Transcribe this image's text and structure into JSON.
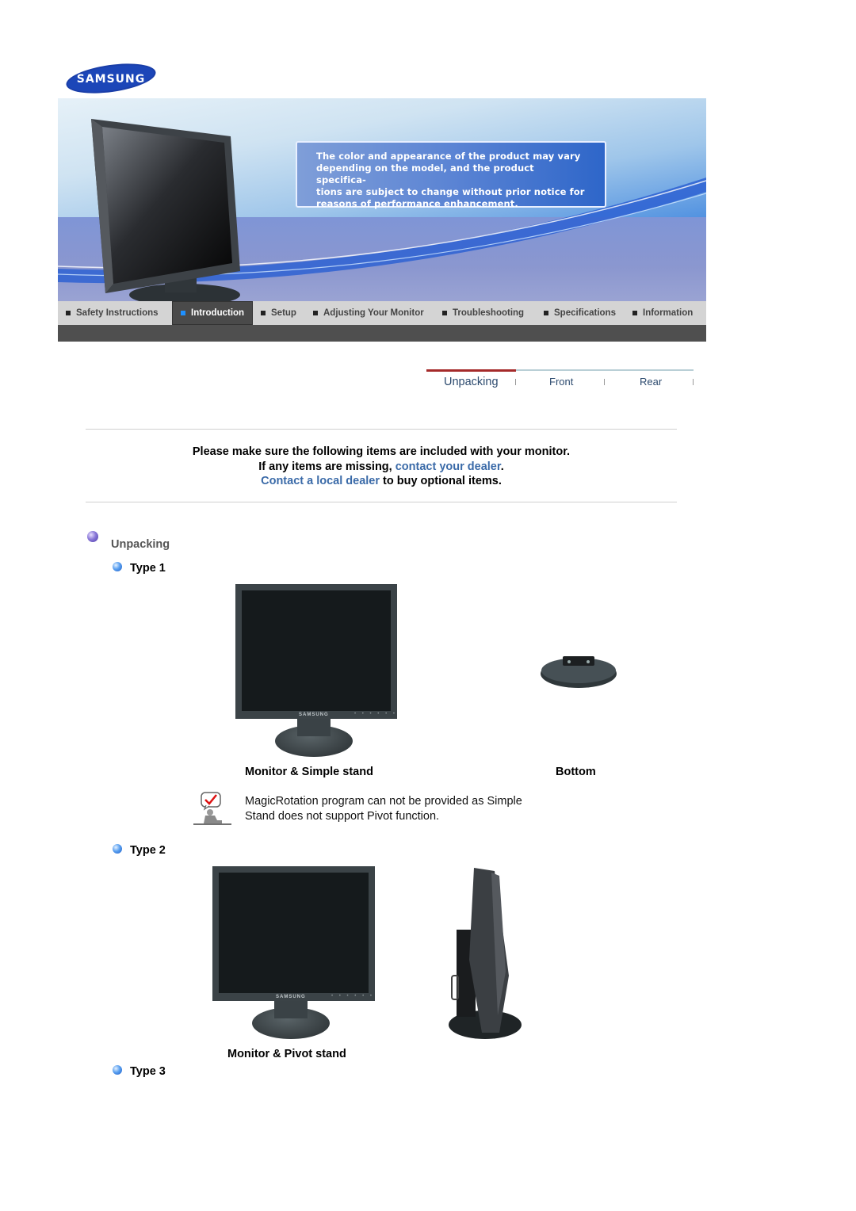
{
  "brand": {
    "logo_text": "SAMSUNG",
    "logo_color": "#1428a0"
  },
  "banner": {
    "notice": "The color and appearance of the product may vary depending on the model, and the product specifica-tions are subject to change without prior notice for reasons of performance enhancement.",
    "notice_lines": [
      "The color and appearance of the product may vary",
      "depending on the model, and the product specifica-",
      "tions are subject to change without prior notice for",
      "reasons of performance enhancement."
    ]
  },
  "nav": {
    "items": [
      {
        "label": "Safety Instructions",
        "active": false
      },
      {
        "label": "Introduction",
        "active": true
      },
      {
        "label": "Setup",
        "active": false
      },
      {
        "label": "Adjusting Your Monitor",
        "active": false
      },
      {
        "label": "Troubleshooting",
        "active": false
      },
      {
        "label": "Specifications",
        "active": false
      },
      {
        "label": "Information",
        "active": false
      }
    ],
    "active_color": "#1e90ff"
  },
  "subtabs": [
    {
      "label": "Unpacking",
      "active": true
    },
    {
      "label": "Front",
      "active": false
    },
    {
      "label": "Rear",
      "active": false
    }
  ],
  "intro": {
    "line1": "Please make sure the following items are included with your monitor.",
    "line2_prefix": "If any items are missing, ",
    "line2_link": "contact your dealer",
    "line2_suffix": ".",
    "line3_link": "Contact a local dealer",
    "line3_suffix": " to buy optional items.",
    "link_color": "#3a6aa8"
  },
  "section": {
    "title": "Unpacking",
    "types": [
      {
        "label": "Type 1",
        "items": [
          {
            "caption": "Monitor & Simple stand",
            "image": "monitor-front-simple-stand"
          },
          {
            "caption": "Bottom",
            "image": "stand-bottom"
          }
        ],
        "note": {
          "icon": "check-note-icon",
          "line1": "MagicRotation program can not be provided as Simple",
          "line2": "Stand does not support Pivot function."
        }
      },
      {
        "label": "Type 2",
        "items": [
          {
            "caption": "Monitor & Pivot stand",
            "image": "monitor-front-pivot-stand"
          },
          {
            "caption": "",
            "image": "monitor-side-pivot-stand"
          }
        ]
      },
      {
        "label": "Type 3",
        "items": []
      }
    ]
  },
  "monitor_brand_text": "SAMSUNG",
  "monitor_buttons": "• • • • • •"
}
